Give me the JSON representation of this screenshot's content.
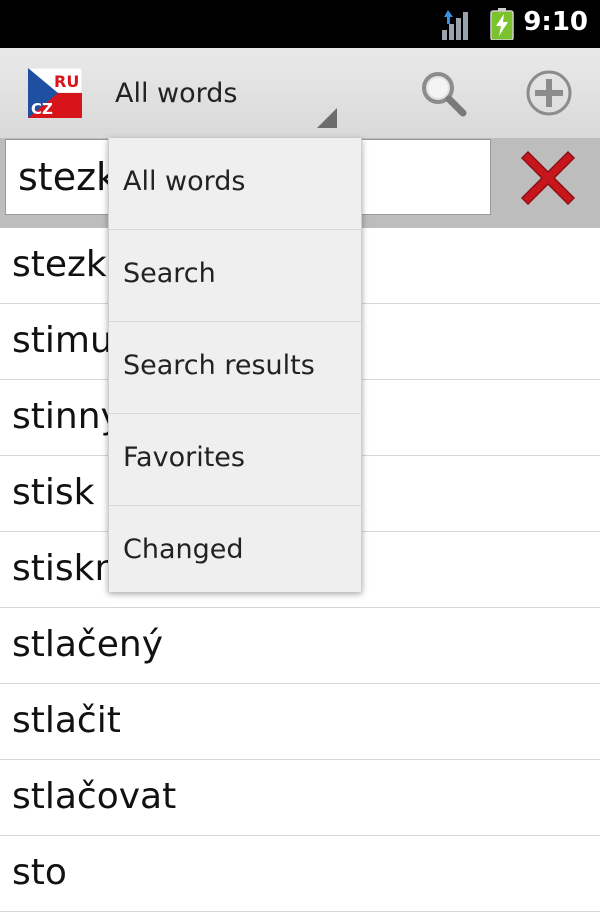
{
  "status_bar": {
    "time": "9:10",
    "signal_icon": "signal-icon",
    "battery_icon": "battery-charging-icon"
  },
  "action_bar": {
    "logo_text_top": "RU",
    "logo_text_bottom": "CZ",
    "spinner_selected": "All words",
    "search_icon": "search-icon",
    "add_icon": "add-icon"
  },
  "search": {
    "value": "stezk",
    "clear_icon": "close-icon"
  },
  "dropdown": {
    "options": [
      "All words",
      "Search",
      "Search results",
      "Favorites",
      "Changed"
    ]
  },
  "list": {
    "items": [
      "stezk",
      "stimu",
      "stinný",
      "stisk",
      "stiskn",
      "stlačený",
      "stlačit",
      "stlačovat",
      "sto"
    ]
  },
  "colors": {
    "clear_red": "#c8161d",
    "flag_blue": "#1f4fa0",
    "flag_red": "#d7141a"
  }
}
